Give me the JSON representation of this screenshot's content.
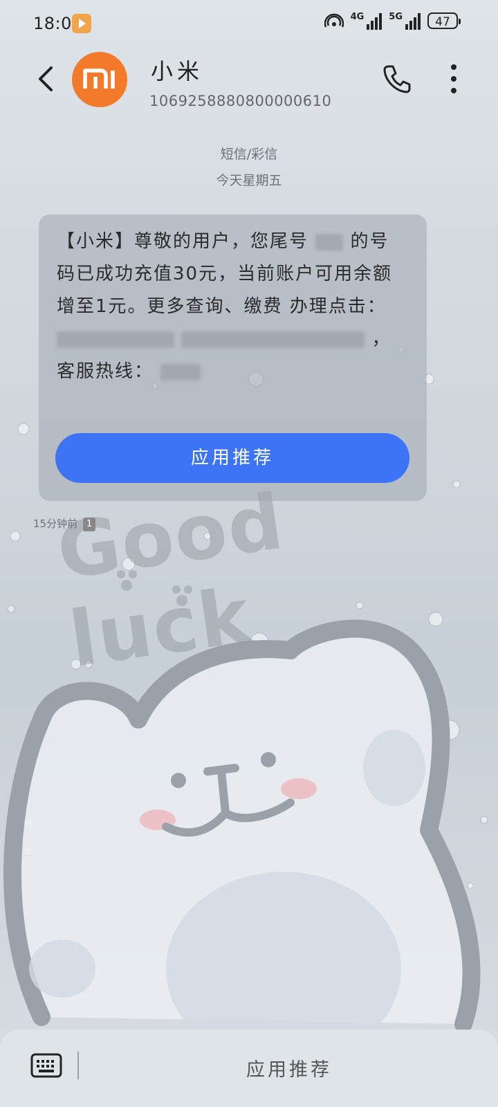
{
  "status_bar": {
    "time": "18:04",
    "network_1": "4G",
    "network_2": "5G",
    "battery": "47"
  },
  "header": {
    "contact_name": "小米",
    "phone_number": "1069258880800000610",
    "avatar_logo": "mi"
  },
  "thread_meta": {
    "type": "短信/彩信",
    "date": "今天星期五"
  },
  "message": {
    "part1": "【小米】尊敬的用户，您尾号",
    "part2": "的号码已成功充值30元，当前账户可用余额增至1元。更多查询、缴费 办理点击：",
    "part3": "，客服热线：",
    "button_label": "应用推荐",
    "time": "15分钟前",
    "sim": "1"
  },
  "wallpaper": {
    "text": "Good luck"
  },
  "bottom_bar": {
    "action_label": "应用推荐"
  },
  "colors": {
    "accent": "#3c74f5",
    "avatar": "#f37a2a"
  }
}
